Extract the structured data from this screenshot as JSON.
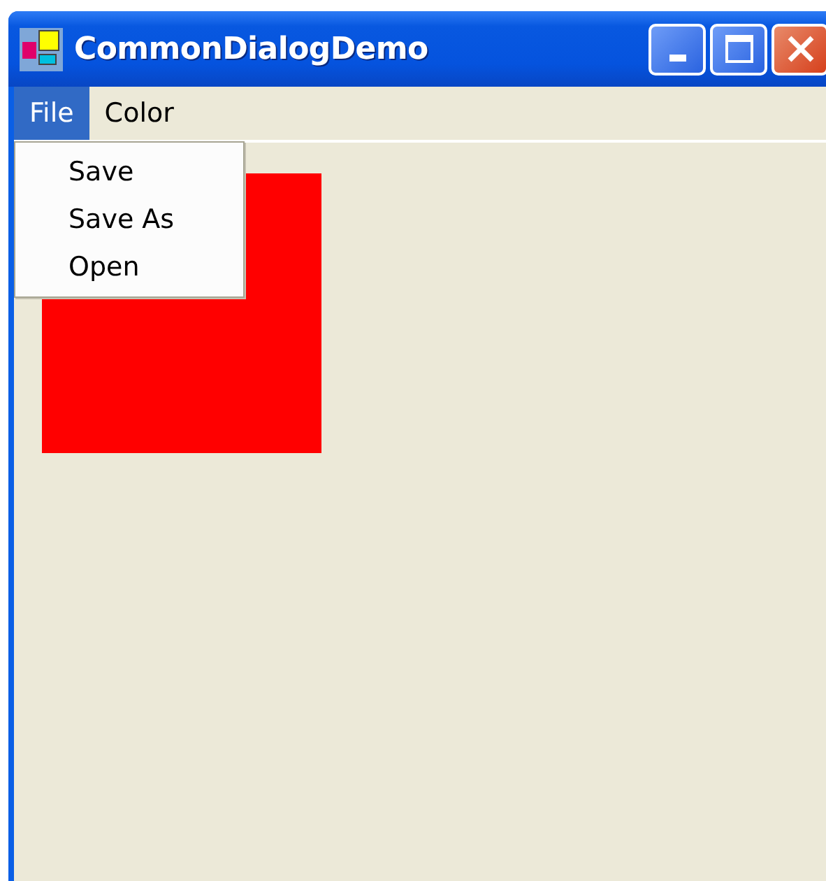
{
  "window": {
    "title": "CommonDialogDemo"
  },
  "menu": [
    {
      "label": "File",
      "selected": true
    },
    {
      "label": "Color",
      "selected": false
    }
  ],
  "dropdown": {
    "items": [
      {
        "label": "Save",
        "selected": false
      },
      {
        "label": "Save As",
        "selected": false
      },
      {
        "label": "Open",
        "selected": false
      }
    ]
  }
}
